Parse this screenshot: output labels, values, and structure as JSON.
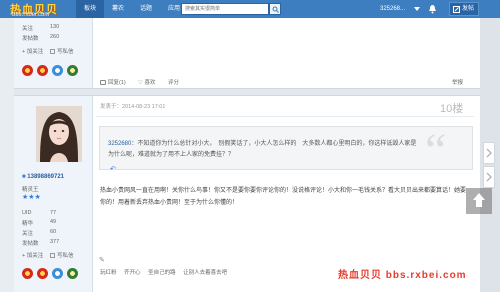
{
  "logo": {
    "title": "热血贝贝",
    "url": "bbs.rxbei.com"
  },
  "nav": {
    "items": [
      "板块",
      "薯农",
      "话题",
      "应用"
    ]
  },
  "search": {
    "placeholder": "搜索其实很简单"
  },
  "user": {
    "name": "325268..."
  },
  "post_button": {
    "label": "发帖"
  },
  "prev_user": {
    "links": [
      "加关注",
      "写私信"
    ],
    "stats": [
      {
        "label": "关注",
        "value": "130"
      },
      {
        "label": "发帖数",
        "value": "260"
      }
    ]
  },
  "prev_actions": {
    "reply": "回复(1)",
    "like": "喜欢",
    "rate": "评分",
    "report": "举报"
  },
  "poster": {
    "name": "13898869721",
    "rank": "精灵王",
    "stars": "★★★",
    "stats": [
      {
        "label": "UID",
        "value": "77"
      },
      {
        "label": "精华",
        "value": "49"
      },
      {
        "label": "关注",
        "value": "60"
      },
      {
        "label": "发帖数",
        "value": "377"
      }
    ],
    "links": [
      "加关注",
      "写私信"
    ]
  },
  "post": {
    "time": "发表于：2014-08-23 17:01",
    "floor": "10楼",
    "quote_user": "3252680",
    "quote_text": "：不知道你为什么总针对小大，　别假笑话了，小大人怎么样的　大多数人都心里明白的，你这样诋毁人家是为什么呢，难道就为了用不上人家的免费挂？？",
    "body": "热血小贵网风一直在用啊！关你什么鸟事！你又不是要你要你评论你的！没说格评论！小大和你一毛钱关系？看大贝贝出来都要算话！她要你的！用着新丢弃热血小贵网！至于为什么你懂的！"
  },
  "tags": [
    "玩红粉",
    "齐开心",
    "圣自己的路",
    "让别人去着喜去吧"
  ],
  "watermark": "热血贝贝 bbs.rxbei.com",
  "colors": {
    "topbar": "#3d7ec0",
    "accent": "#2a5f9c",
    "watermark": "#e83b2c"
  }
}
